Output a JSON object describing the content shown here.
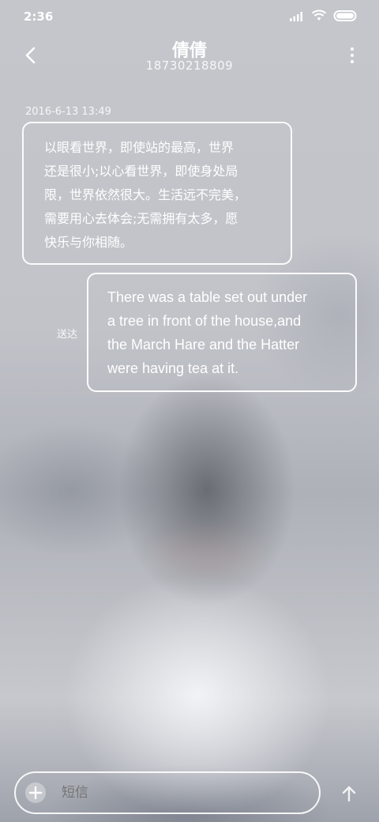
{
  "status_bar": {
    "time": "2:36"
  },
  "header": {
    "contact_name": "倩倩",
    "phone_number": "18730218809"
  },
  "messages": {
    "timestamp": "2016-6-13 13:49",
    "incoming": "以眼看世界，即使站的最高，世界还是很小;以心看世界，即使身处局限，世界依然很大。生活远不完美，需要用心去体会;无需拥有太多，愿快乐与你相随。",
    "incoming_lines": [
      "以眼看世界，即使站的最高，世界",
      "还是很小;以心看世界，即使身处局",
      "限，世界依然很大。生活远不完美，",
      "需要用心去体会;无需拥有太多，愿",
      "快乐与你相随。"
    ],
    "outgoing_lines": [
      "There was a table set out under",
      "a tree in front of the house,and",
      "the March Hare and the Hatter",
      "were having tea at it."
    ],
    "delivered_label": "送达"
  },
  "composer": {
    "placeholder": "短信"
  }
}
